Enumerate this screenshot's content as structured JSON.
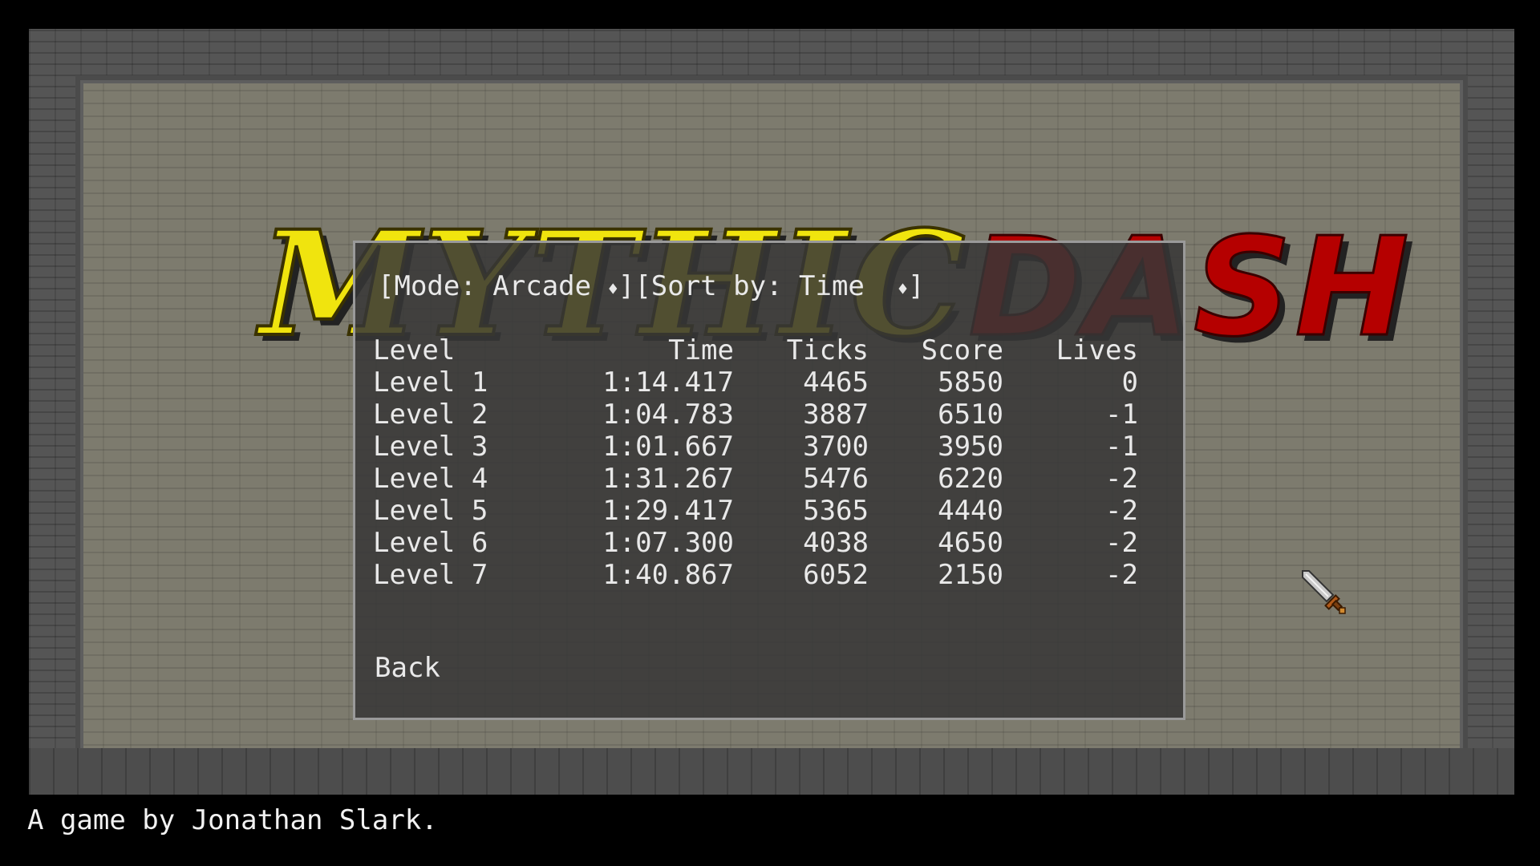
{
  "logo": {
    "part1": "MYTHIC",
    "part2": "DASH"
  },
  "controls": {
    "mode_label": "[Mode: Arcade ",
    "mode_arrow": "♦",
    "mode_close": "]",
    "sort_label": "[Sort by: Time  ",
    "sort_arrow": "♦",
    "sort_close": "]"
  },
  "table": {
    "headers": [
      "Level",
      "Time",
      "Ticks",
      "Score",
      "Lives"
    ],
    "rows": [
      [
        "Level 1",
        "1:14.417",
        "4465",
        "5850",
        "0"
      ],
      [
        "Level 2",
        "1:04.783",
        "3887",
        "6510",
        "-1"
      ],
      [
        "Level 3",
        "1:01.667",
        "3700",
        "3950",
        "-1"
      ],
      [
        "Level 4",
        "1:31.267",
        "5476",
        "6220",
        "-2"
      ],
      [
        "Level 5",
        "1:29.417",
        "5365",
        "4440",
        "-2"
      ],
      [
        "Level 6",
        "1:07.300",
        "4038",
        "4650",
        "-2"
      ],
      [
        "Level 7",
        "1:40.867",
        "6052",
        "2150",
        "-2"
      ]
    ]
  },
  "back_label": "Back",
  "credit": "A game by Jonathan Slark.",
  "cursor_icon": "sword-cursor-icon",
  "colors": {
    "logo_yellow": "#f0e40e",
    "logo_red": "#b50000",
    "panel_bg": "#373737"
  }
}
